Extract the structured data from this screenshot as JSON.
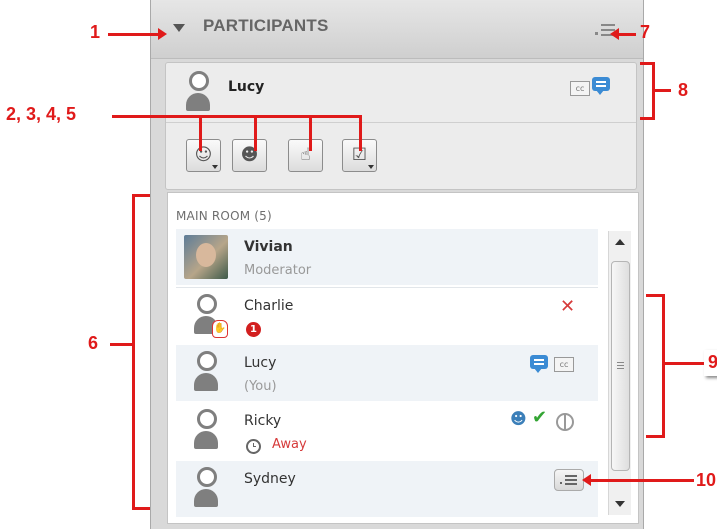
{
  "panel": {
    "title": "PARTICIPANTS",
    "collapse_icon": "triangle-down-icon",
    "menu_icon": "panel-options-icon"
  },
  "me": {
    "name": "Lucy",
    "icons": [
      "cc-icon",
      "chat-icon"
    ],
    "tools": [
      {
        "name": "emotion-button",
        "glyph": "☺",
        "has_dropdown": true
      },
      {
        "name": "profile-button",
        "glyph": "☻",
        "has_dropdown": false
      },
      {
        "name": "raise-hand-button",
        "glyph": "☝",
        "has_dropdown": false
      },
      {
        "name": "poll-button",
        "glyph": "☑",
        "has_dropdown": true
      }
    ]
  },
  "room": {
    "label": "MAIN ROOM (5)",
    "participants": [
      {
        "name": "Vivian",
        "subtitle": "Moderator"
      },
      {
        "name": "Charlie",
        "badge": "1"
      },
      {
        "name": "Lucy",
        "subtitle": "(You)"
      },
      {
        "name": "Ricky",
        "status": "Away"
      },
      {
        "name": "Sydney"
      }
    ]
  },
  "callouts": {
    "c1": "1",
    "c2345": "2, 3, 4, 5",
    "c6": "6",
    "c7": "7",
    "c8": "8",
    "c9": "9",
    "c10": "10"
  },
  "colors": {
    "callout": "#e01a1a",
    "chat": "#3b8bd4",
    "away": "#d63a3a",
    "check": "#34a534"
  }
}
